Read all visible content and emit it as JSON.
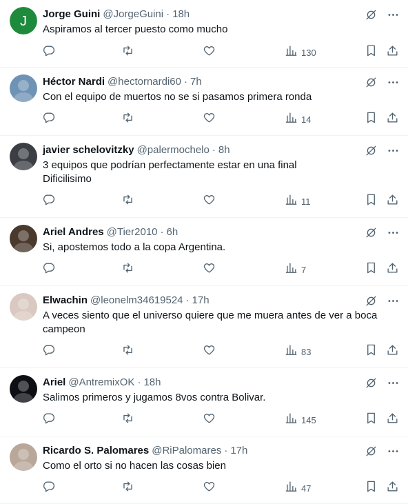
{
  "tweets": [
    {
      "name": "Jorge Guini",
      "handle": "@JorgeGuini",
      "time": "18h",
      "text": "Aspiramos al tercer puesto como mucho",
      "views": "130",
      "avatar": {
        "type": "letter",
        "letter": "J",
        "color": "#1e8a3c"
      }
    },
    {
      "name": "Héctor Nardi",
      "handle": "@hectornardi60",
      "time": "7h",
      "text": "Con el equipo de muertos no se si pasamos primera ronda",
      "views": "14",
      "avatar": {
        "type": "photo",
        "color": "#6f93b5"
      }
    },
    {
      "name": "javier schelovitzky",
      "handle": "@palermochelo",
      "time": "8h",
      "text": "3 equipos que podrían perfectamente estar en una final\nDificilisimo",
      "views": "11",
      "avatar": {
        "type": "photo",
        "color": "#3b3f44"
      }
    },
    {
      "name": "Ariel Andres",
      "handle": "@Tier2010",
      "time": "6h",
      "text": "Si, apostemos todo a la copa Argentina.",
      "views": "7",
      "avatar": {
        "type": "photo",
        "color": "#4a3a2e"
      }
    },
    {
      "name": "Elwachin",
      "handle": "@leonelm34619524",
      "time": "17h",
      "text": "A veces siento que el universo quiere que me muera antes de ver a boca campeon",
      "views": "83",
      "avatar": {
        "type": "photo",
        "color": "#d9c9c0"
      }
    },
    {
      "name": "Ariel",
      "handle": "@AntremixOK",
      "time": "18h",
      "text": "Salimos primeros y jugamos 8vos contra Bolivar.",
      "views": "145",
      "avatar": {
        "type": "photo",
        "color": "#0d0f14"
      }
    },
    {
      "name": "Ricardo S. Palomares",
      "handle": "@RiPalomares",
      "time": "17h",
      "text": "Como el orto si no hacen las cosas bien",
      "views": "47",
      "avatar": {
        "type": "photo",
        "color": "#b9a79a"
      }
    }
  ],
  "icons": {
    "grok": "grok-icon",
    "more": "more-options-icon",
    "reply": "reply-icon",
    "retweet": "retweet-icon",
    "like": "like-heart-icon",
    "views": "views-chart-icon",
    "bookmark": "bookmark-icon",
    "share": "share-icon"
  },
  "colors": {
    "text": "#0f1419",
    "secondary": "#536471",
    "divider": "#eff3f4"
  }
}
